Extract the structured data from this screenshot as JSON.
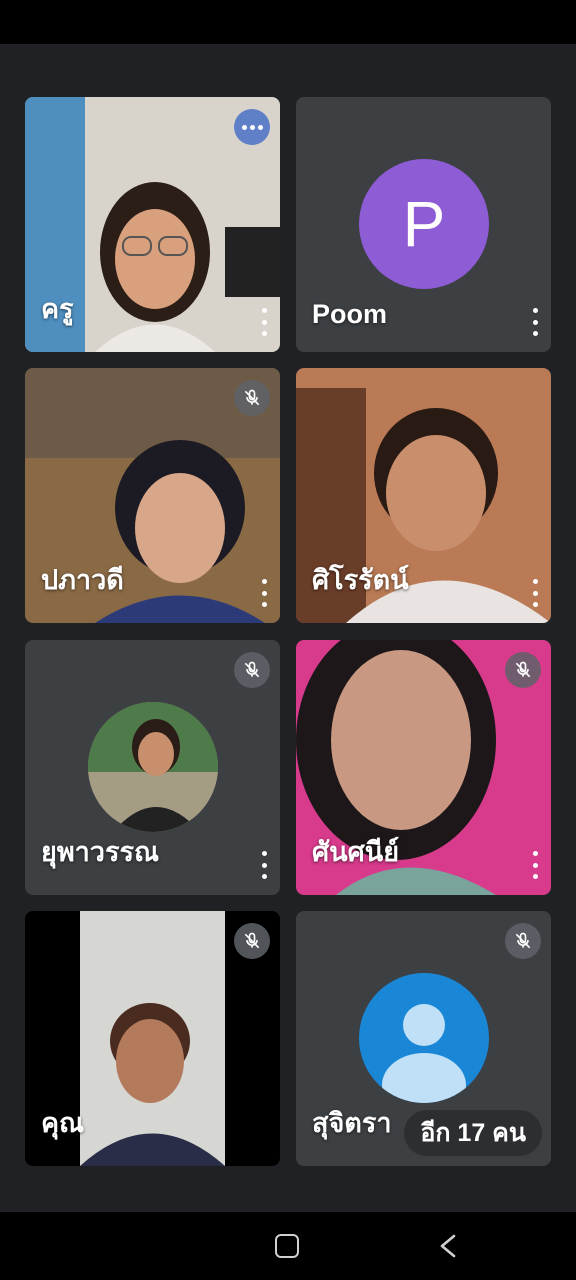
{
  "participants": [
    {
      "name": "ครู",
      "video": true,
      "muted": false
    },
    {
      "name": "Poom",
      "avatar_letter": "P",
      "avatar_color": "#8e5cd4",
      "video": false
    },
    {
      "name": "ปภาวดี",
      "video": true,
      "muted": true
    },
    {
      "name": "ศิโรรัตน์",
      "video": true,
      "muted": false
    },
    {
      "name": "ยุพาวรรณ",
      "video": false,
      "muted": true
    },
    {
      "name": "ศันศนีย์",
      "video": true,
      "muted": true
    },
    {
      "name": "คุณ",
      "video": true,
      "muted": true
    },
    {
      "name": "สุจิตรา",
      "video": false,
      "muted": true
    }
  ],
  "more_participants_label": "อีก 17 คน",
  "icons": {
    "mute": "mic-off-icon",
    "kebab": "more-vert-icon",
    "options": "more-horiz-icon",
    "home": "home-square-icon",
    "back": "chevron-left-icon"
  },
  "colors": {
    "background": "#202124",
    "tile": "#3c4043",
    "generic_avatar": "#1a87d6"
  }
}
